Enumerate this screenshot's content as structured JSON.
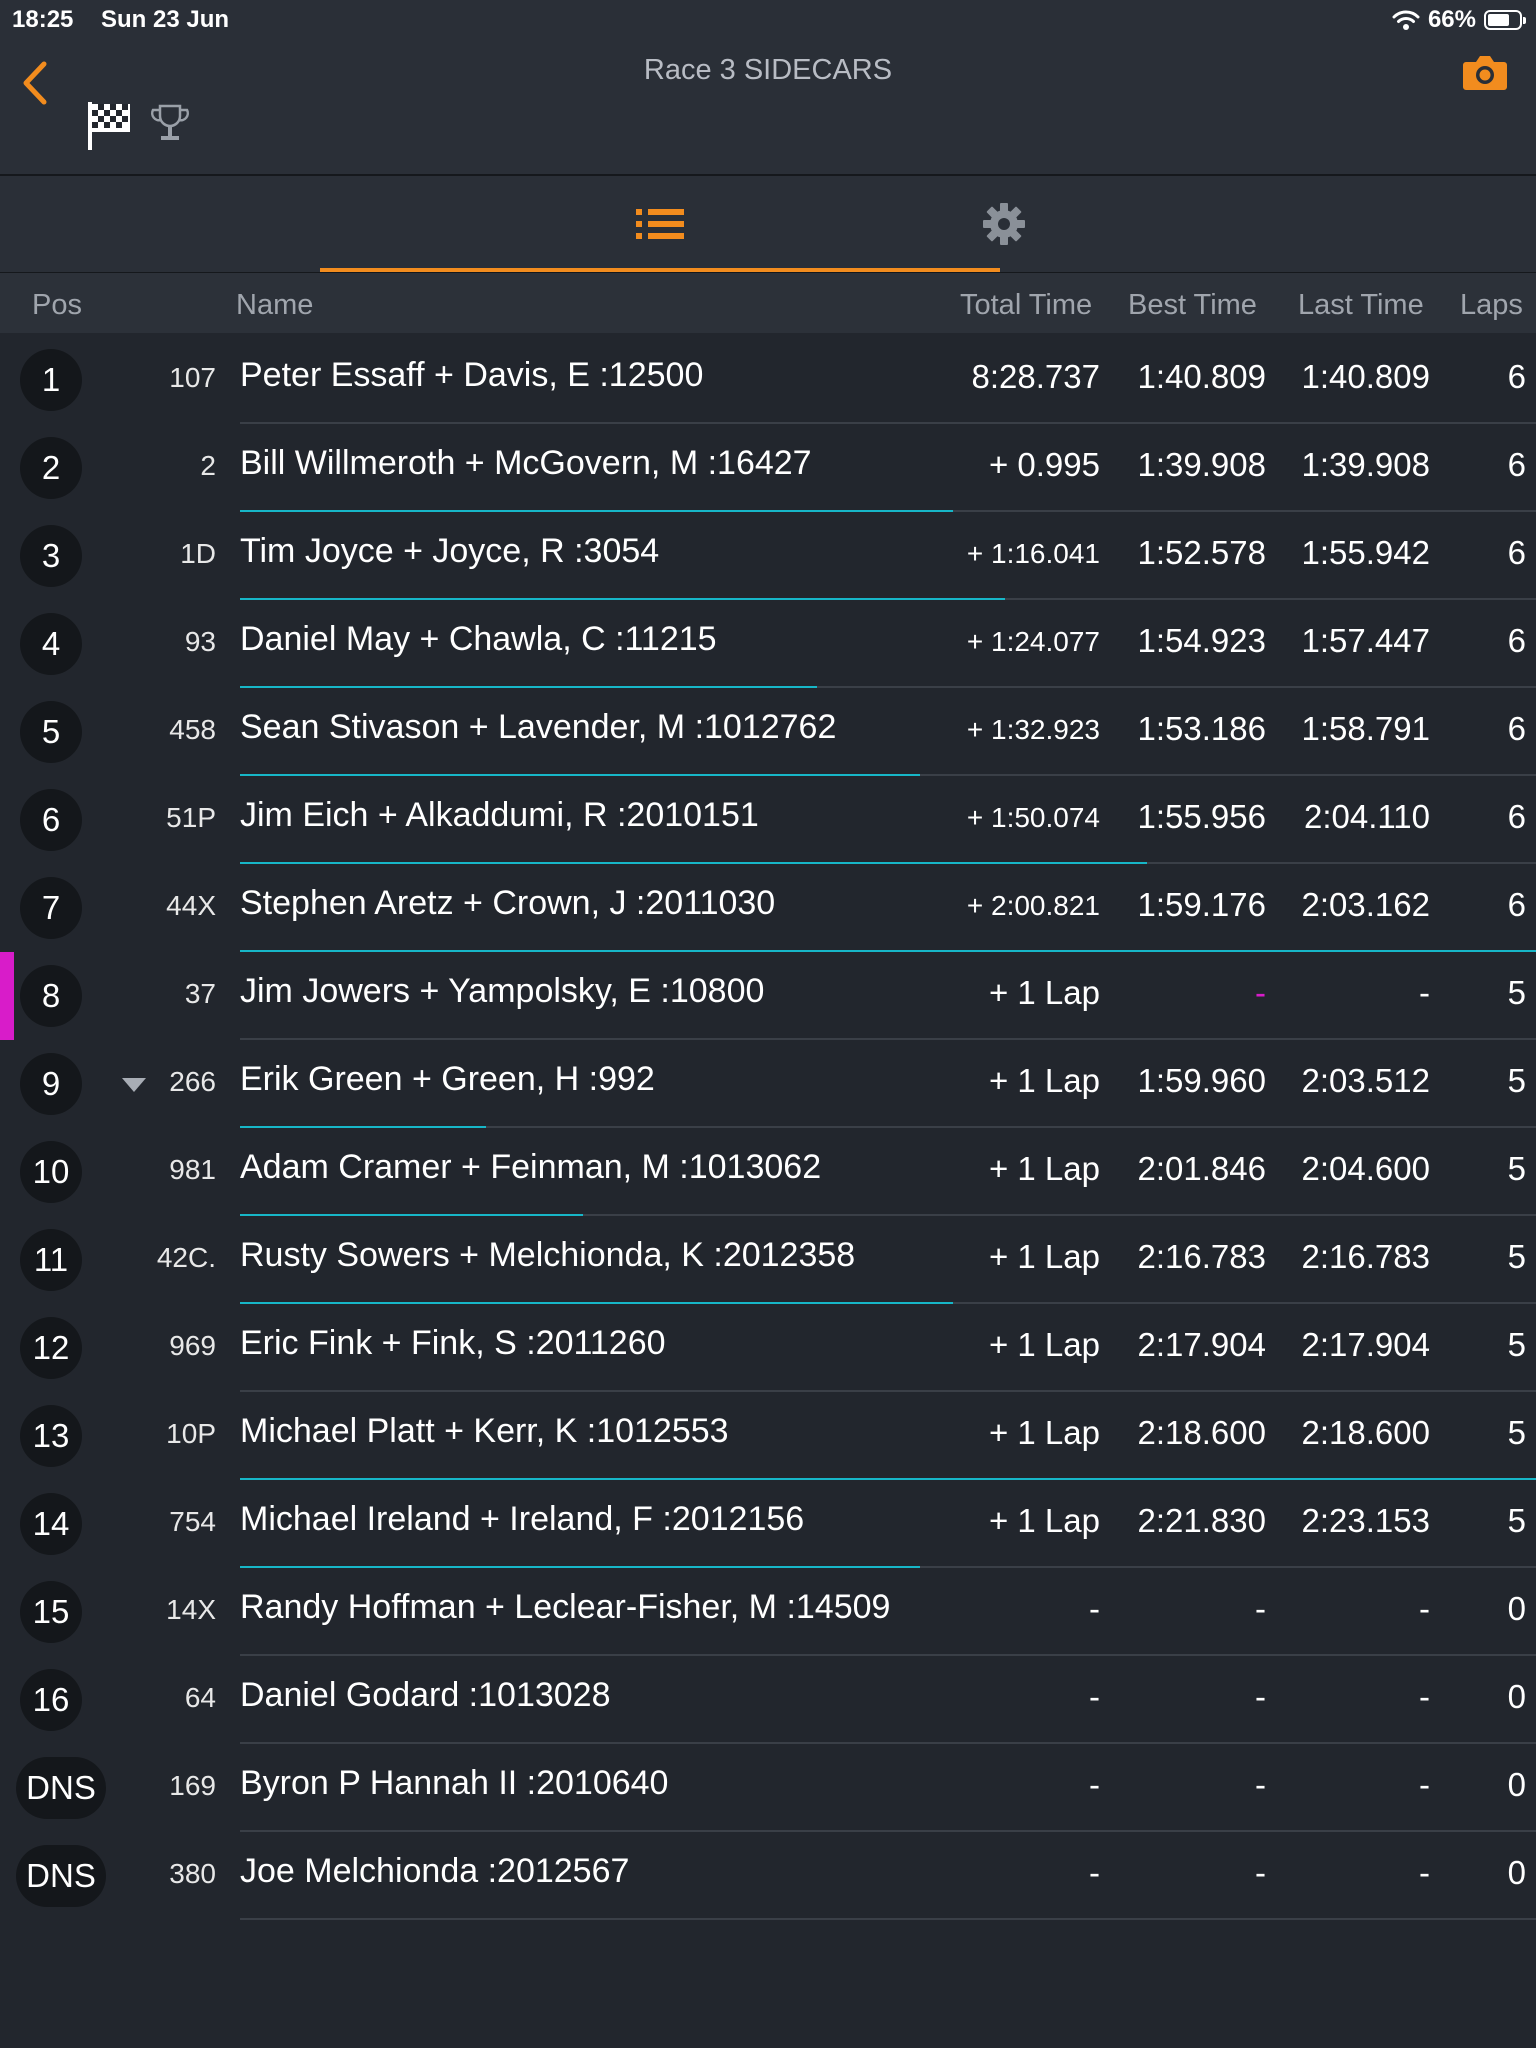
{
  "status": {
    "time": "18:25",
    "date": "Sun 23 Jun",
    "battery": "66%",
    "battery_level": 0.66
  },
  "nav": {
    "title": "Race 3 SIDECARS"
  },
  "columns": {
    "pos": "Pos",
    "name": "Name",
    "total": "Total Time",
    "best": "Best Time",
    "last": "Last Time",
    "laps": "Laps"
  },
  "colors": {
    "accent": "#f28c1e",
    "progress": "#17b6c7",
    "highlight": "#d81cc9",
    "background": "#22262d"
  },
  "rows": [
    {
      "pos": "1",
      "num": "107",
      "name": "Peter Essaff + Davis, E :12500",
      "total": "8:28.737",
      "best": "1:40.809",
      "last": "1:40.809",
      "laps": "6",
      "progress": 0
    },
    {
      "pos": "2",
      "num": "2",
      "name": "Bill Willmeroth + McGovern, M :16427",
      "total": "+ 0.995",
      "best": "1:39.908",
      "last": "1:39.908",
      "laps": "6",
      "progress": 0.55
    },
    {
      "pos": "3",
      "num": "1D",
      "name": "Tim Joyce + Joyce, R :3054",
      "total": "+ 1:16.041",
      "best": "1:52.578",
      "last": "1:55.942",
      "laps": "6",
      "progress": 0.59
    },
    {
      "pos": "4",
      "num": "93",
      "name": "Daniel May + Chawla, C :11215",
      "total": "+ 1:24.077",
      "best": "1:54.923",
      "last": "1:57.447",
      "laps": "6",
      "progress": 0.445
    },
    {
      "pos": "5",
      "num": "458",
      "name": "Sean Stivason + Lavender, M :1012762",
      "total": "+ 1:32.923",
      "best": "1:53.186",
      "last": "1:58.791",
      "laps": "6",
      "progress": 0.525
    },
    {
      "pos": "6",
      "num": "51P",
      "name": "Jim Eich + Alkaddumi, R :2010151",
      "total": "+ 1:50.074",
      "best": "1:55.956",
      "last": "2:04.110",
      "laps": "6",
      "progress": 0.7
    },
    {
      "pos": "7",
      "num": "44X",
      "name": "Stephen Aretz + Crown, J :2011030",
      "total": "+ 2:00.821",
      "best": "1:59.176",
      "last": "2:03.162",
      "laps": "6",
      "progress": 1.0
    },
    {
      "pos": "8",
      "num": "37",
      "name": "Jim Jowers + Yampolsky, E :10800",
      "total": "+ 1 Lap",
      "best": "-",
      "last": "-",
      "laps": "5",
      "progress": 0,
      "marker": true
    },
    {
      "pos": "9",
      "num": "266",
      "name": "Erik Green + Green, H :992",
      "total": "+ 1 Lap",
      "best": "1:59.960",
      "last": "2:03.512",
      "laps": "5",
      "progress": 0.19,
      "down": true
    },
    {
      "pos": "10",
      "num": "981",
      "name": "Adam Cramer + Feinman, M :1013062",
      "total": "+ 1 Lap",
      "best": "2:01.846",
      "last": "2:04.600",
      "laps": "5",
      "progress": 0.265
    },
    {
      "pos": "11",
      "num": "42C.",
      "name": "Rusty Sowers + Melchionda, K :2012358",
      "total": "+ 1 Lap",
      "best": "2:16.783",
      "last": "2:16.783",
      "laps": "5",
      "progress": 0.55
    },
    {
      "pos": "12",
      "num": "969",
      "name": "Eric Fink + Fink, S :2011260",
      "total": "+ 1 Lap",
      "best": "2:17.904",
      "last": "2:17.904",
      "laps": "5",
      "progress": 0
    },
    {
      "pos": "13",
      "num": "10P",
      "name": "Michael Platt + Kerr, K :1012553",
      "total": "+ 1 Lap",
      "best": "2:18.600",
      "last": "2:18.600",
      "laps": "5",
      "progress": 1.0
    },
    {
      "pos": "14",
      "num": "754",
      "name": "Michael Ireland + Ireland, F :2012156",
      "total": "+ 1 Lap",
      "best": "2:21.830",
      "last": "2:23.153",
      "laps": "5",
      "progress": 0.525
    },
    {
      "pos": "15",
      "num": "14X",
      "name": "Randy Hoffman + Leclear-Fisher, M :14509",
      "total": "-",
      "best": "-",
      "last": "-",
      "laps": "0",
      "progress": 0
    },
    {
      "pos": "16",
      "num": "64",
      "name": "Daniel Godard :1013028",
      "total": "-",
      "best": "-",
      "last": "-",
      "laps": "0",
      "progress": 0
    },
    {
      "pos": "DNS",
      "num": "169",
      "name": "Byron P Hannah II :2010640",
      "total": "-",
      "best": "-",
      "last": "-",
      "laps": "0",
      "progress": 0
    },
    {
      "pos": "DNS",
      "num": "380",
      "name": "Joe Melchionda :2012567",
      "total": "-",
      "best": "-",
      "last": "-",
      "laps": "0",
      "progress": 0
    }
  ]
}
